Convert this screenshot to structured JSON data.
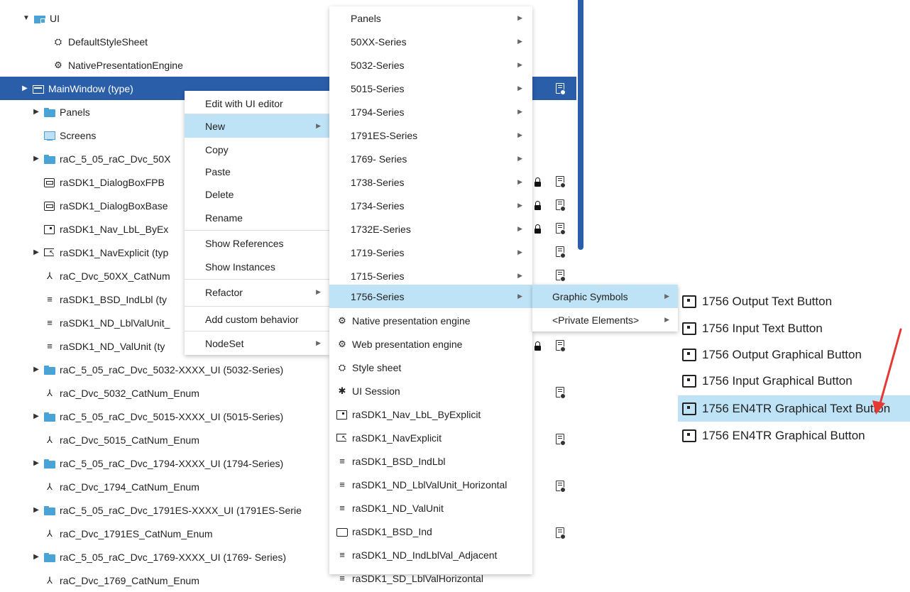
{
  "tree": {
    "rows": [
      {
        "label": "UI",
        "icon": "ui-folder-icon",
        "toggle": "▼"
      },
      {
        "label": "DefaultStyleSheet",
        "icon": "style-sheet-icon"
      },
      {
        "label": "NativePresentationEngine",
        "icon": "gear-icon"
      },
      {
        "label": "MainWindow (type)",
        "icon": "window-icon",
        "toggle": "▶"
      },
      {
        "label": "Panels",
        "icon": "folder-icon",
        "toggle": "▶"
      },
      {
        "label": "Screens",
        "icon": "screen-icon"
      },
      {
        "label": "raC_5_05_raC_Dvc_50X",
        "icon": "folder-icon",
        "toggle": "▶"
      },
      {
        "label": "raSDK1_DialogBoxFPB",
        "icon": "dialog-icon"
      },
      {
        "label": "raSDK1_DialogBoxBase",
        "icon": "dialog-icon"
      },
      {
        "label": "raSDK1_Nav_LbL_ByEx",
        "icon": "button-icon"
      },
      {
        "label": "raSDK1_NavExplicit (typ",
        "icon": "nav-icon",
        "toggle": "▶"
      },
      {
        "label": "raC_Dvc_50XX_CatNum",
        "icon": "enum-icon"
      },
      {
        "label": "raSDK1_BSD_IndLbl (ty",
        "icon": "lines-icon"
      },
      {
        "label": "raSDK1_ND_LblValUnit_",
        "icon": "lines-icon"
      },
      {
        "label": "raSDK1_ND_ValUnit (ty",
        "icon": "lines-icon"
      },
      {
        "label": "raC_5_05_raC_Dvc_5032-XXXX_UI (5032-Series)",
        "icon": "folder-icon",
        "toggle": "▶"
      },
      {
        "label": "raC_Dvc_5032_CatNum_Enum",
        "icon": "enum-icon"
      },
      {
        "label": "raC_5_05_raC_Dvc_5015-XXXX_UI (5015-Series)",
        "icon": "folder-icon",
        "toggle": "▶"
      },
      {
        "label": "raC_Dvc_5015_CatNum_Enum",
        "icon": "enum-icon"
      },
      {
        "label": "raC_5_05_raC_Dvc_1794-XXXX_UI (1794-Series)",
        "icon": "folder-icon",
        "toggle": "▶"
      },
      {
        "label": "raC_Dvc_1794_CatNum_Enum",
        "icon": "enum-icon"
      },
      {
        "label": "raC_5_05_raC_Dvc_1791ES-XXXX_UI (1791ES-Serie",
        "icon": "folder-icon",
        "toggle": "▶"
      },
      {
        "label": "raC_Dvc_1791ES_CatNum_Enum",
        "icon": "enum-icon"
      },
      {
        "label": "raC_5_05_raC_Dvc_1769-XXXX_UI (1769- Series)",
        "icon": "folder-icon",
        "toggle": "▶"
      },
      {
        "label": "raC_Dvc_1769_CatNum_Enum",
        "icon": "enum-icon"
      }
    ]
  },
  "context_menu": {
    "items": [
      {
        "label": "Edit with UI editor"
      },
      {
        "label": "New",
        "submenu": true
      },
      {
        "label": "Copy"
      },
      {
        "label": "Paste"
      },
      {
        "label": "Delete"
      },
      {
        "label": "Rename"
      },
      {
        "label": "Show References"
      },
      {
        "label": "Show Instances"
      },
      {
        "label": "Refactor",
        "submenu": true
      },
      {
        "label": "Add custom behavior"
      },
      {
        "label": "NodeSet",
        "submenu": true
      }
    ]
  },
  "new_menu": {
    "items": [
      {
        "label": "Panels",
        "submenu": true
      },
      {
        "label": "50XX-Series",
        "submenu": true
      },
      {
        "label": "5032-Series",
        "submenu": true
      },
      {
        "label": "5015-Series",
        "submenu": true
      },
      {
        "label": "1794-Series",
        "submenu": true
      },
      {
        "label": "1791ES-Series",
        "submenu": true
      },
      {
        "label": "1769- Series",
        "submenu": true
      },
      {
        "label": "1738-Series",
        "submenu": true
      },
      {
        "label": "1734-Series",
        "submenu": true
      },
      {
        "label": "1732E-Series",
        "submenu": true
      },
      {
        "label": "1719-Series",
        "submenu": true
      },
      {
        "label": "1715-Series",
        "submenu": true
      },
      {
        "label": "1756-Series",
        "submenu": true
      },
      {
        "label": "Native presentation engine",
        "icon": "gear-icon"
      },
      {
        "label": "Web presentation engine",
        "icon": "gear-icon"
      },
      {
        "label": "Style sheet",
        "icon": "style-sheet-icon"
      },
      {
        "label": "UI Session",
        "icon": "session-icon"
      },
      {
        "label": "raSDK1_Nav_LbL_ByExplicit",
        "icon": "button-icon"
      },
      {
        "label": "raSDK1_NavExplicit",
        "icon": "nav-icon"
      },
      {
        "label": "raSDK1_BSD_IndLbl",
        "icon": "lines-icon"
      },
      {
        "label": "raSDK1_ND_LblValUnit_Horizontal",
        "icon": "lines-icon"
      },
      {
        "label": "raSDK1_ND_ValUnit",
        "icon": "lines-icon"
      },
      {
        "label": "raSDK1_BSD_Ind",
        "icon": "rect-icon"
      },
      {
        "label": "raSDK1_ND_IndLblVal_Adjacent",
        "icon": "lines-icon"
      },
      {
        "label": "raSDK1_SD_LblValHorizontal",
        "icon": "lines-icon"
      }
    ]
  },
  "series_menu": {
    "items": [
      {
        "label": "Graphic Symbols",
        "submenu": true
      },
      {
        "label": "<Private Elements>",
        "submenu": true
      }
    ]
  },
  "symbols_menu": {
    "items": [
      {
        "label": "1756 Output Text Button"
      },
      {
        "label": "1756 Input Text Button"
      },
      {
        "label": "1756 Output Graphical Button"
      },
      {
        "label": "1756 Input Graphical Button"
      },
      {
        "label": "1756 EN4TR Graphical Text Button"
      },
      {
        "label": "1756 EN4TR Graphical Button"
      }
    ]
  },
  "colors": {
    "selection": "#2a5ea8",
    "highlight": "#bfe3f6",
    "annotation_arrow": "#e53935"
  }
}
